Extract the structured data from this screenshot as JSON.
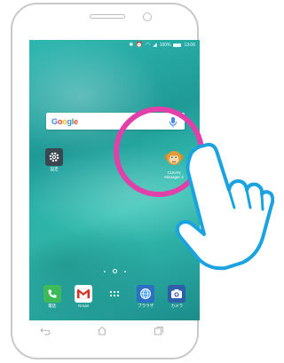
{
  "status_bar": {
    "battery_text": "100%",
    "time": "13:06"
  },
  "search_widget": {
    "logo_letters": [
      "G",
      "o",
      "o",
      "g",
      "l",
      "e"
    ],
    "mic_icon": "microphone-icon"
  },
  "home_apps": {
    "settings": {
      "label": "設定",
      "icon": "gear-icon"
    },
    "clean_master": {
      "label_line1": "CLEAN",
      "label_line2": "Manager 2",
      "icon": "monkey-mascot-icon"
    }
  },
  "dock": [
    {
      "label": "電話",
      "icon": "phone-icon",
      "color": "#3fba5a"
    },
    {
      "label": "Gmail",
      "icon": "gmail-icon",
      "color": "#ffffff"
    },
    {
      "label": "",
      "icon": "app-drawer-icon",
      "color": ""
    },
    {
      "label": "ブラウザ",
      "icon": "globe-icon",
      "color": "#2d6fc2"
    },
    {
      "label": "カメラ",
      "icon": "camera-icon",
      "color": "#2e5fa8"
    }
  ],
  "nav_bar": {
    "icons": [
      "back-icon",
      "home-icon",
      "recents-icon"
    ]
  },
  "colors": {
    "wallpaper": "#25a6a2",
    "highlight": "#e040a8",
    "hand_outline": "#1aa3e0"
  }
}
